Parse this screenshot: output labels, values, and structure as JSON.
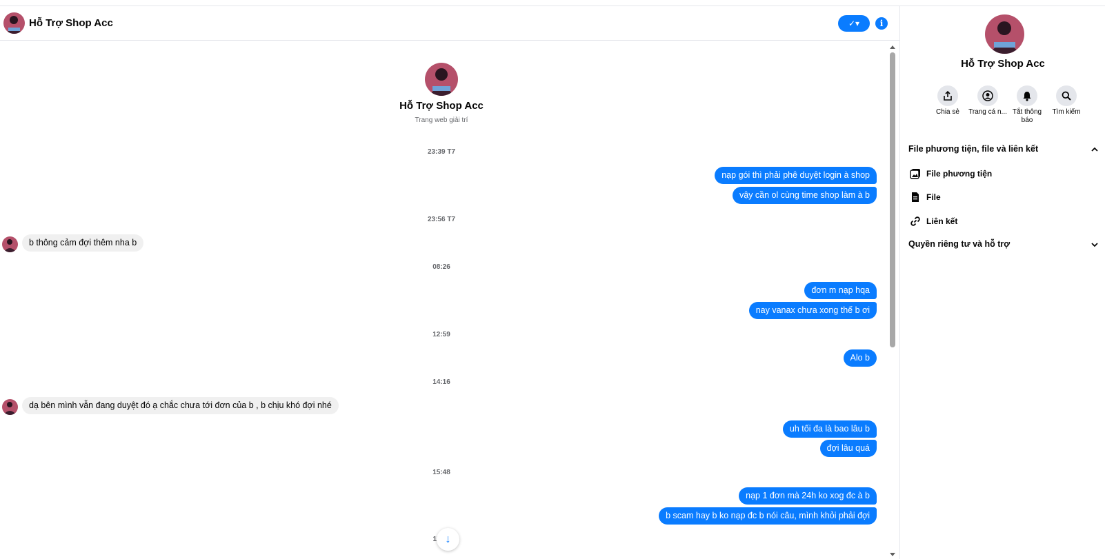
{
  "header": {
    "contact_name": "Hỗ Trợ Shop Acc",
    "check_button_label": "✓▾",
    "info_button_label": "i"
  },
  "intro": {
    "name": "Hỗ Trợ Shop Acc",
    "subtitle": "Trang web giải trí"
  },
  "timestamps": [
    "23:39 T7",
    "23:56 T7",
    "08:26",
    "12:59",
    "14:16",
    "15:48",
    "17:11"
  ],
  "messages": [
    {
      "text": "nạp gói thì phải phê duyệt login à shop"
    },
    {
      "text": "vậy cần ol cùng time shop làm à b"
    },
    {
      "text": "b thông cảm đợi thêm nha b"
    },
    {
      "text": "đơn m nạp hqa"
    },
    {
      "text": "nay vanax chưa xong thế b ơi"
    },
    {
      "text": "Alo b"
    },
    {
      "text": "dạ bên mình vẫn đang duyệt đó ạ chắc chưa tới đơn của b , b chịu khó đợi nhé"
    },
    {
      "text": "uh tối đa là bao lâu b"
    },
    {
      "text": "đợi lâu quá"
    },
    {
      "text": "nạp 1 đơn mà 24h ko xog đc à b"
    },
    {
      "text": "b scam hay b ko nạp đc b nói câu, mình khỏi phải đợi"
    }
  ],
  "scroll_down_label": "↓",
  "panel": {
    "name": "Hỗ Trợ Shop Acc",
    "actions": [
      {
        "icon": "share-icon",
        "label": "Chia sẻ"
      },
      {
        "icon": "profile-icon",
        "label": "Trang cá n..."
      },
      {
        "icon": "bell-icon",
        "label": "Tắt thông báo"
      },
      {
        "icon": "search-icon",
        "label": "Tìm kiếm"
      }
    ],
    "section_media": "File phương tiện, file và liên kết",
    "items": [
      {
        "icon": "photo-icon",
        "label": "File phương tiện"
      },
      {
        "icon": "file-icon",
        "label": "File"
      },
      {
        "icon": "link-icon",
        "label": "Liên kết"
      }
    ],
    "section_privacy": "Quyền riêng tư và hỗ trợ"
  },
  "colors": {
    "accent": "#0a7cff",
    "incoming_bubble": "#f0f0f0",
    "muted_text": "#65676b"
  }
}
